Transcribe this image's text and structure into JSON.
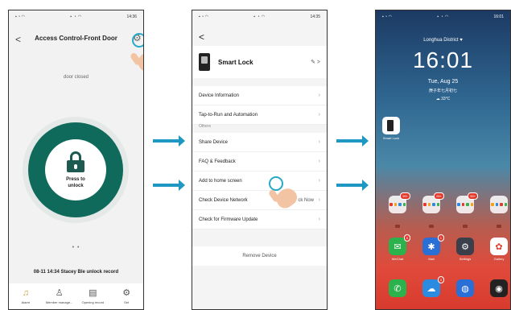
{
  "phone1": {
    "status_time": "14:36",
    "back": "<",
    "title": "Access Control-Front Door",
    "door_status": "door closed",
    "unlock_label_1": "Press to",
    "unlock_label_2": "unlock",
    "page_dots": "• •",
    "record": "08-11 14:34 Stacey Ble unlock record",
    "tabs": [
      {
        "label": "Alarm",
        "icon": "alarm-icon"
      },
      {
        "label": "Member manage...",
        "icon": "person-icon"
      },
      {
        "label": "Opening record",
        "icon": "record-icon"
      },
      {
        "label": "Set",
        "icon": "gear-icon"
      }
    ]
  },
  "phone2": {
    "status_time": "14:35",
    "back": "<",
    "device_name": "Smart Lock",
    "edit": "✎ >",
    "items_top": [
      {
        "label": "Device Information"
      },
      {
        "label": "Tap-to-Run and Automation"
      }
    ],
    "section_label": "Others",
    "items_bottom": [
      {
        "label": "Share Device"
      },
      {
        "label": "FAQ & Feedback"
      },
      {
        "label": "Add to home screen"
      },
      {
        "label": "Check Device Network",
        "extra": "ck Now"
      },
      {
        "label": "Check for Firmware Update"
      }
    ],
    "remove": "Remove Device"
  },
  "phone3": {
    "status_time": "16:01",
    "district": "Longhua District ♥",
    "time": "16:01",
    "date": "Tue, Aug 25",
    "lunar": "庚子年七月初七",
    "temp": "☁ 33°C",
    "shortcut_label": "Smart Lock",
    "folder_badges": [
      "99+",
      "99+",
      "99+"
    ],
    "apps": [
      {
        "label": "WeChat",
        "badge": "8"
      },
      {
        "label": "Mail",
        "badge": "1"
      },
      {
        "label": "Settings",
        "badge": ""
      },
      {
        "label": "Gallery",
        "badge": ""
      }
    ],
    "dock_badge": "3"
  },
  "colors": {
    "teal": "#0f6a5c",
    "arrow": "#1e97c3",
    "tap": "#27a9c7"
  }
}
